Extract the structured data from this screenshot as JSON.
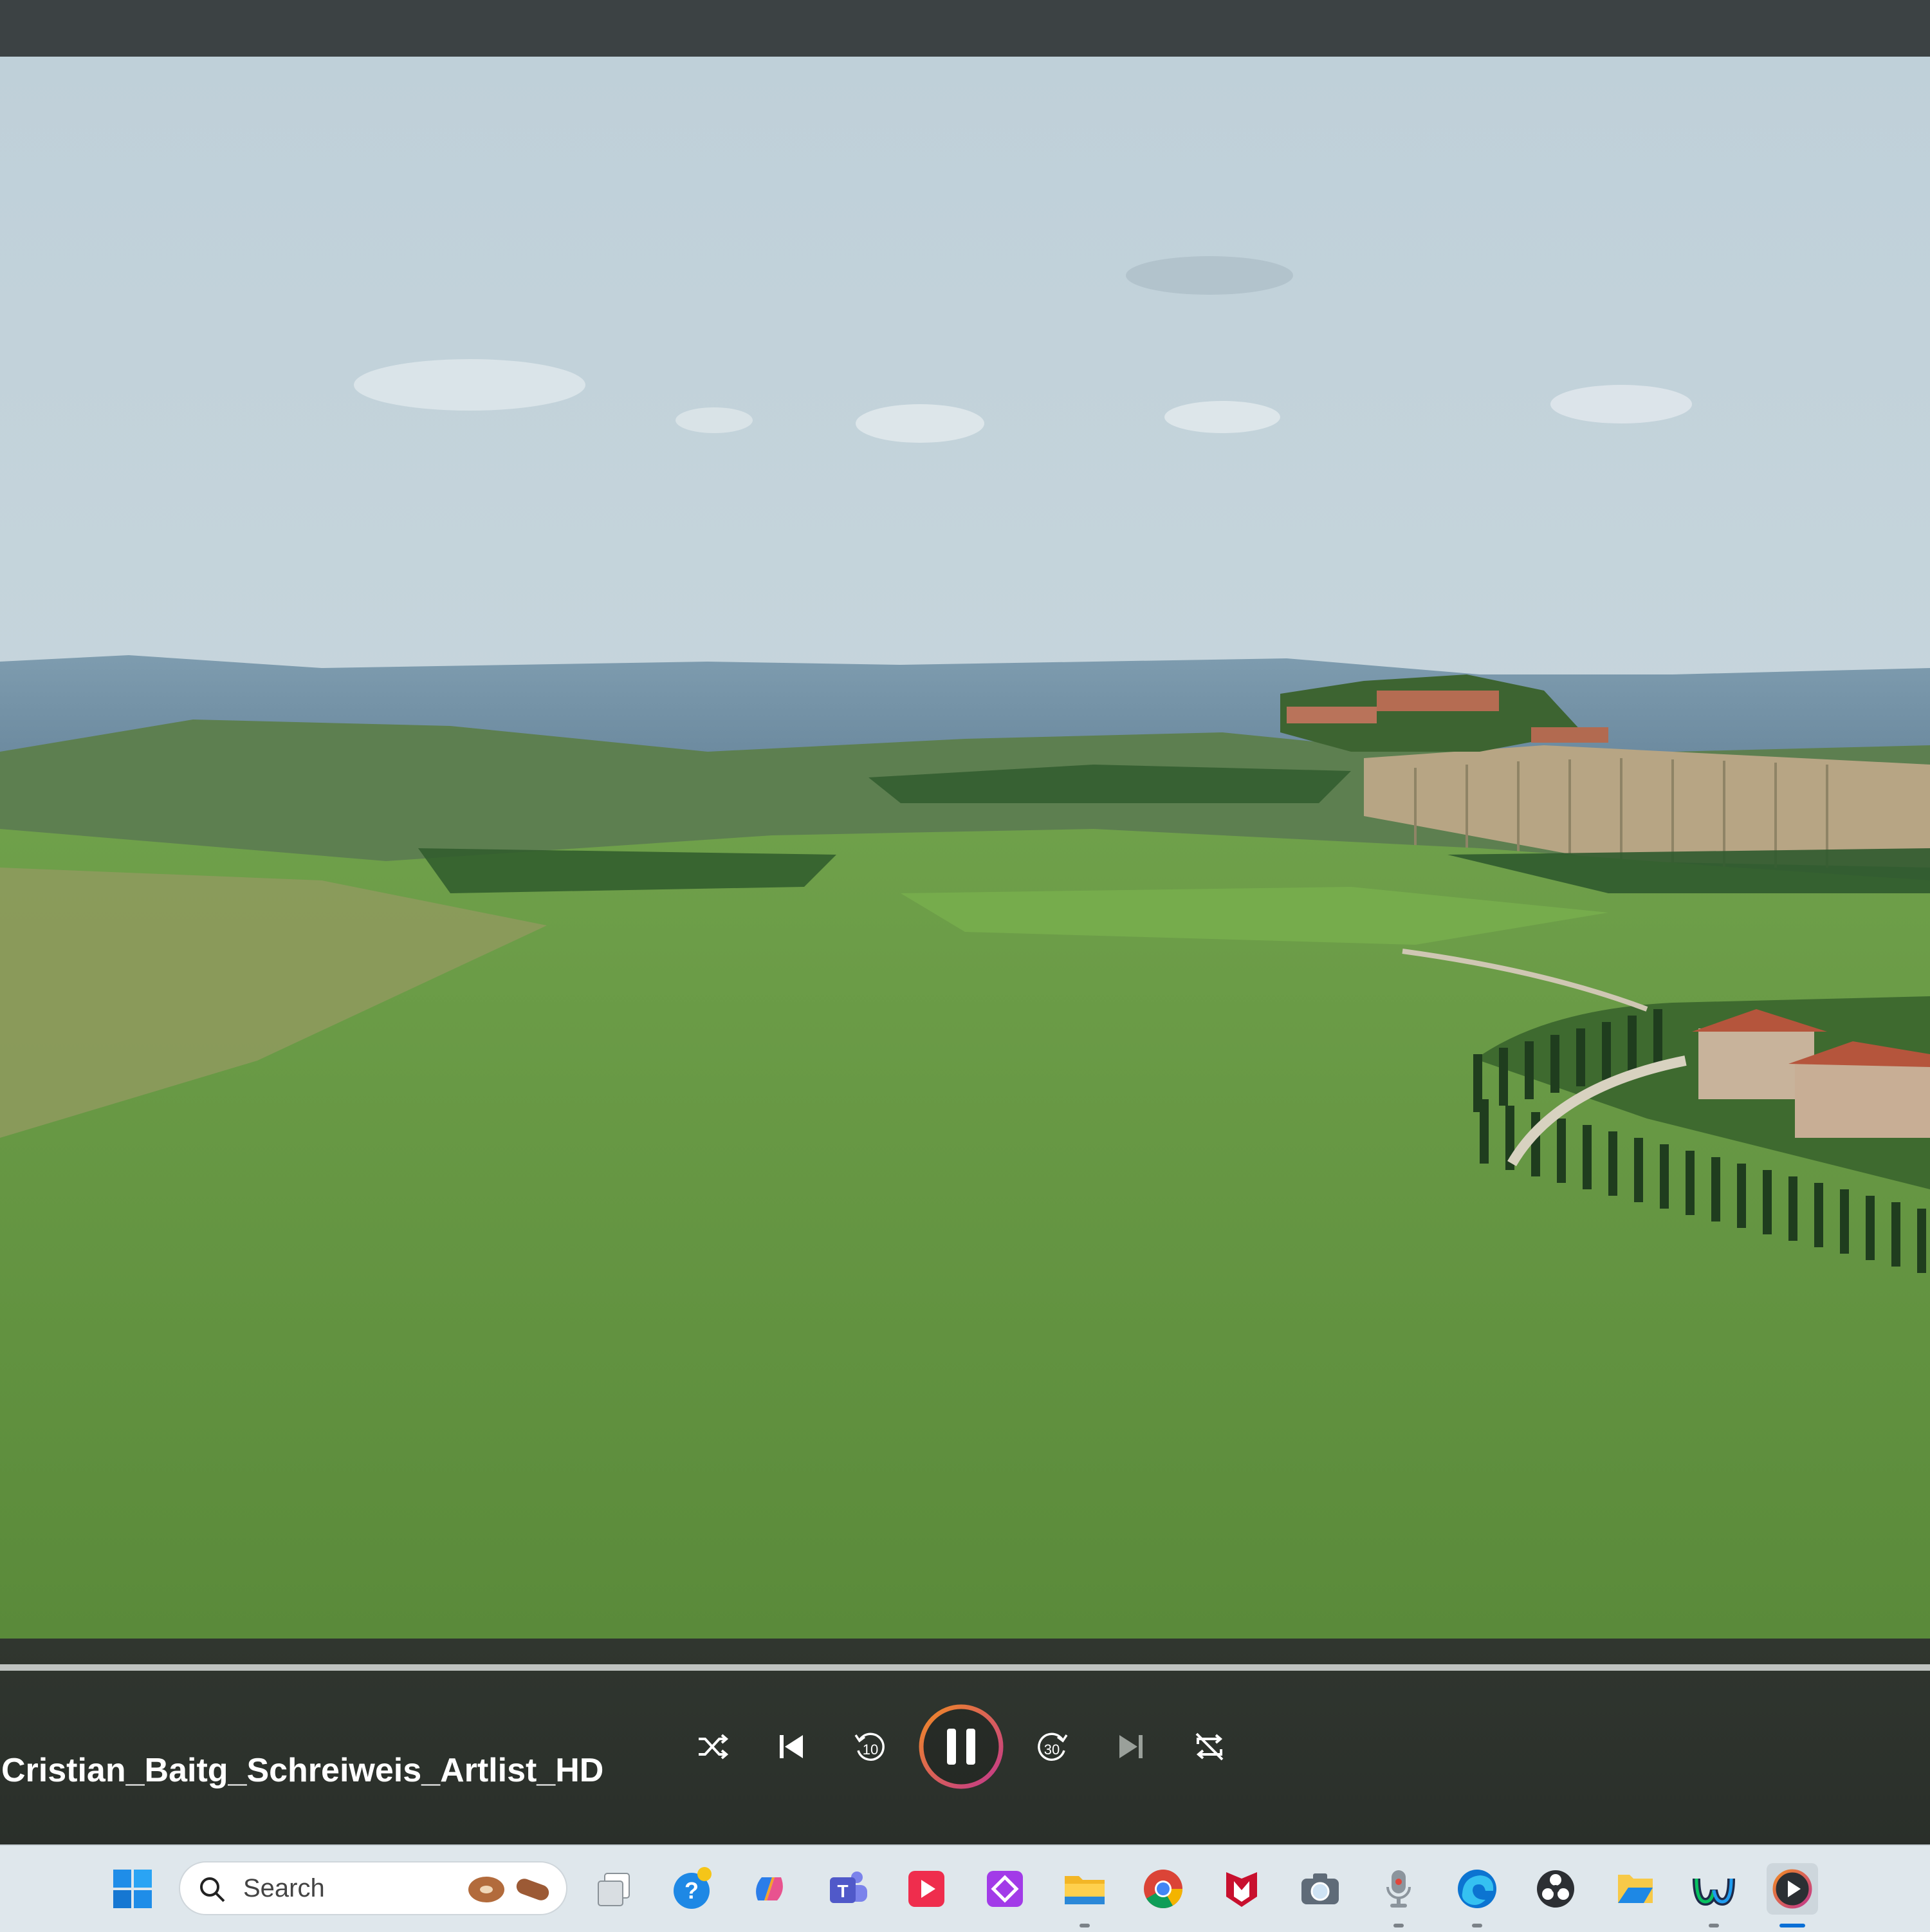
{
  "player": {
    "title": "Cristian_Baitg_Schreiweis_Artlist_HD",
    "state": "playing",
    "progress": 0.0,
    "controls": [
      {
        "name": "shuffle",
        "icon": "shuffle-icon"
      },
      {
        "name": "previous",
        "icon": "previous-track-icon"
      },
      {
        "name": "rewind-10",
        "icon": "rewind-10-icon",
        "label": "10"
      },
      {
        "name": "play-pause",
        "icon": "pause-icon"
      },
      {
        "name": "forward-30",
        "icon": "forward-30-icon",
        "label": "30"
      },
      {
        "name": "next",
        "icon": "next-track-icon"
      },
      {
        "name": "repeat",
        "icon": "repeat-off-icon"
      }
    ],
    "accent_colors": [
      "#f08a24",
      "#c2378c"
    ]
  },
  "taskbar": {
    "search_placeholder": "Search",
    "apps": [
      {
        "name": "start",
        "icon": "windows-start-icon"
      },
      {
        "name": "task-view",
        "icon": "task-view-icon"
      },
      {
        "name": "get-help",
        "icon": "help-icon"
      },
      {
        "name": "copilot",
        "icon": "copilot-icon"
      },
      {
        "name": "teams",
        "icon": "teams-icon"
      },
      {
        "name": "video-app",
        "icon": "red-play-icon"
      },
      {
        "name": "purple-app",
        "icon": "purple-diamond-icon"
      },
      {
        "name": "file-explorer",
        "icon": "folder-icon"
      },
      {
        "name": "chrome",
        "icon": "chrome-icon"
      },
      {
        "name": "mcafee",
        "icon": "mcafee-icon"
      },
      {
        "name": "camera",
        "icon": "camera-icon"
      },
      {
        "name": "voice-recorder",
        "icon": "microphone-icon"
      },
      {
        "name": "edge",
        "icon": "edge-icon"
      },
      {
        "name": "obs",
        "icon": "obs-icon"
      },
      {
        "name": "files",
        "icon": "files-icon"
      },
      {
        "name": "webex",
        "icon": "webex-icon"
      },
      {
        "name": "media-player",
        "icon": "media-player-icon"
      }
    ]
  }
}
